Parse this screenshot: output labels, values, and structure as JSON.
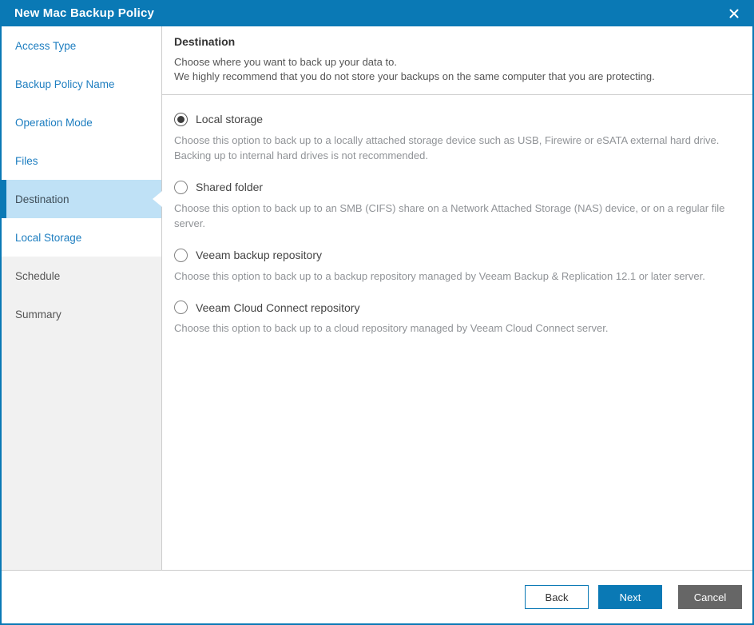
{
  "window": {
    "title": "New Mac Backup Policy"
  },
  "sidebar": {
    "items": [
      {
        "label": "Access Type",
        "state": "enabled"
      },
      {
        "label": "Backup Policy Name",
        "state": "enabled"
      },
      {
        "label": "Operation Mode",
        "state": "enabled"
      },
      {
        "label": "Files",
        "state": "enabled"
      },
      {
        "label": "Destination",
        "state": "current"
      },
      {
        "label": "Local Storage",
        "state": "enabled"
      },
      {
        "label": "Schedule",
        "state": "disabled"
      },
      {
        "label": "Summary",
        "state": "disabled"
      }
    ]
  },
  "header": {
    "title": "Destination",
    "line1": "Choose where you want to back up your data to.",
    "line2": "We highly recommend that you do not store your backups on the same computer that you are protecting."
  },
  "options": [
    {
      "label": "Local storage",
      "selected": true,
      "description": "Choose this option to back up to a locally attached storage device such as USB, Firewire or eSATA external hard drive. Backing up to internal hard drives is not recommended."
    },
    {
      "label": "Shared folder",
      "selected": false,
      "description": "Choose this option to back up to an SMB (CIFS) share on a Network Attached Storage (NAS) device, or on a regular file server."
    },
    {
      "label": "Veeam backup repository",
      "selected": false,
      "description": "Choose this option to back up to a backup repository managed by Veeam Backup & Replication 12.1 or later server."
    },
    {
      "label": "Veeam Cloud Connect repository",
      "selected": false,
      "description": "Choose this option to back up to a cloud repository managed by Veeam Cloud Connect server."
    }
  ],
  "footer": {
    "back_label": "Back",
    "next_label": "Next",
    "cancel_label": "Cancel"
  },
  "colors": {
    "accent_blue": "#0a79b5",
    "link_blue": "#1e7ec0",
    "highlight_blue": "#bfe1f6",
    "cancel_gray": "#666666"
  }
}
